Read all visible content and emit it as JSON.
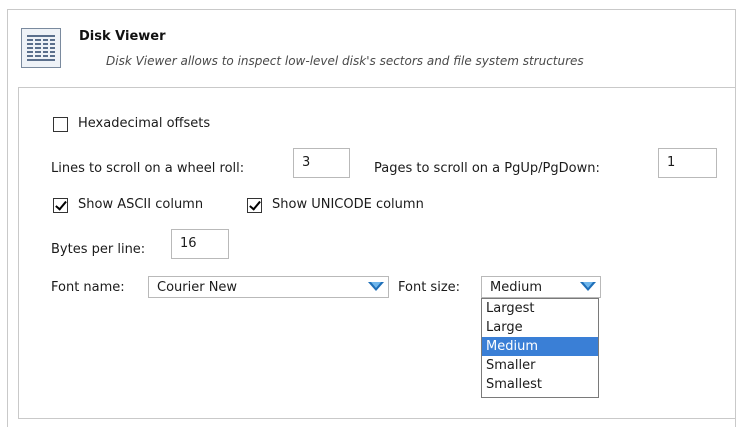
{
  "header": {
    "title": "Disk Viewer",
    "description": "Disk Viewer allows to inspect low-level disk's sectors and file system structures",
    "icon": "disk-viewer-icon"
  },
  "options": {
    "hex_offsets": {
      "label": "Hexadecimal offsets",
      "checked": false
    },
    "lines_to_scroll": {
      "label": "Lines to scroll on a wheel roll:",
      "value": "3"
    },
    "pages_to_scroll": {
      "label": "Pages to scroll on a PgUp/PgDown:",
      "value": "1"
    },
    "show_ascii": {
      "label": "Show ASCII column",
      "checked": true
    },
    "show_unicode": {
      "label": "Show UNICODE column",
      "checked": true
    },
    "bytes_per_line": {
      "label": "Bytes per line:",
      "value": "16"
    },
    "font_name": {
      "label": "Font name:",
      "value": "Courier New"
    },
    "font_size": {
      "label": "Font size:",
      "value": "Medium",
      "options": [
        "Largest",
        "Large",
        "Medium",
        "Smaller",
        "Smallest"
      ],
      "selected_index": 2
    }
  },
  "colors": {
    "selection": "#3a7fd6",
    "arrow": "#1f6fb8",
    "border": "#c9c9c9"
  }
}
